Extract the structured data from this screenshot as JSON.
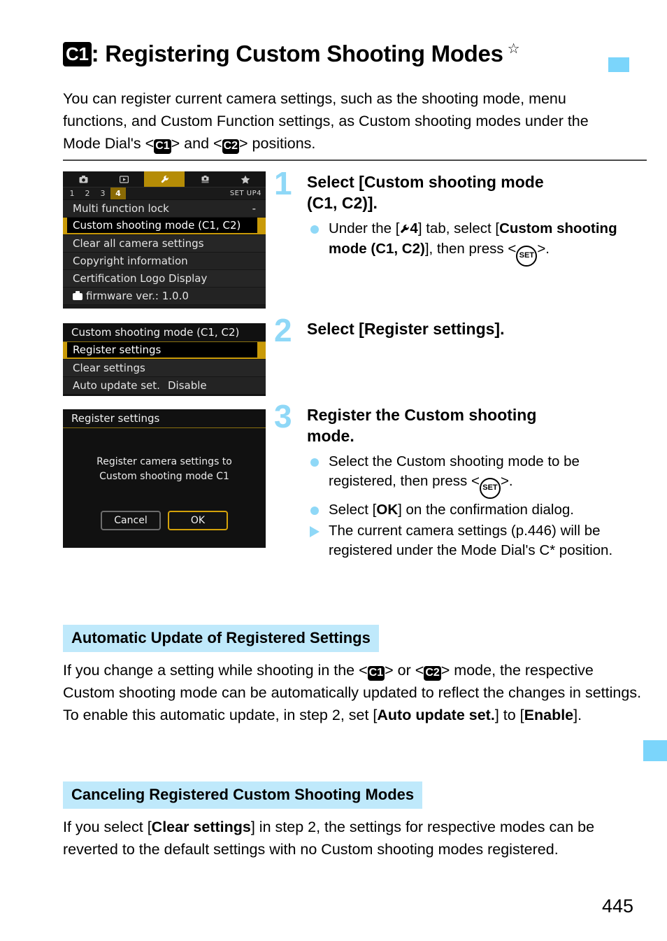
{
  "page": {
    "number": "445",
    "title_badge": "C1",
    "title": ": Registering Custom Shooting Modes",
    "title_star": "☆",
    "intro": "You can register current camera settings, such as the shooting mode, menu functions, and Custom Function settings, as Custom shooting modes under the Mode Dial's <C1> and <C2> positions.",
    "intro_part1": "You can register current camera settings, such as the shooting mode, menu functions, and Custom Function settings, as Custom shooting modes under the Mode Dial's <",
    "intro_badge1": "C1",
    "intro_mid": "> and <",
    "intro_badge2": "C2",
    "intro_part2": "> positions."
  },
  "screenshot1": {
    "tabs": [
      {
        "name": "camera-icon",
        "glyph": "■"
      },
      {
        "name": "playback-icon",
        "glyph": "▶"
      },
      {
        "name": "wrench-icon",
        "glyph": "ƒ"
      },
      {
        "name": "custom-functions-icon",
        "glyph": "■"
      },
      {
        "name": "my-menu-star-icon",
        "glyph": "★"
      }
    ],
    "page_numbers": [
      "1",
      "2",
      "3",
      "4"
    ],
    "active_page": "4",
    "setup_label": "SET UP4",
    "rows": [
      {
        "label": "Multi function lock",
        "value": "-",
        "selected": false,
        "camera_icon": false
      },
      {
        "label": "Custom shooting mode (C1, C2)",
        "value": "",
        "selected": true,
        "camera_icon": false
      },
      {
        "label": "Clear all camera settings",
        "value": "",
        "selected": false,
        "camera_icon": false
      },
      {
        "label": "Copyright information",
        "value": "",
        "selected": false,
        "camera_icon": false
      },
      {
        "label": "Certification Logo Display",
        "value": "",
        "selected": false,
        "camera_icon": false
      },
      {
        "label": "firmware ver.: 1.0.0",
        "value": "",
        "selected": false,
        "camera_icon": true
      }
    ]
  },
  "screenshot2": {
    "header": "Custom shooting mode (C1, C2)",
    "rows": [
      {
        "label": "Register settings",
        "value": "",
        "selected": true
      },
      {
        "label": "Clear settings",
        "value": "",
        "selected": false
      },
      {
        "label": "Auto update set.",
        "value": "Disable",
        "selected": false
      }
    ]
  },
  "screenshot3": {
    "header": "Register settings",
    "message_line1": "Register camera settings to",
    "message_line2": "Custom shooting mode C1",
    "cancel_label": "Cancel",
    "ok_label": "OK"
  },
  "steps": [
    {
      "number": "1",
      "title_line1": "Select [Custom shooting mode",
      "title_line2": "(C1, C2)].",
      "bullet_prefix": "Under the [",
      "bullet_tab": "4",
      "bullet_mid": "] tab, select [",
      "bullet_bold": "Custom shooting mode (C1, C2)",
      "bullet_suffix": "], then press <",
      "bullet_set": "SET",
      "bullet_end": ">."
    },
    {
      "number": "2",
      "title_line1": "Select [Register settings].",
      "title_line2": ""
    },
    {
      "number": "3",
      "title_line1": "Register the Custom shooting",
      "title_line2": "mode.",
      "b1_pre": "Select the Custom shooting mode to be registered, then press <",
      "b1_set": "SET",
      "b1_post": ">.",
      "b2_pre": "Select [",
      "b2_bold": "OK",
      "b2_post": "] on the confirmation dialog.",
      "b3": "The current camera settings (p.446) will be registered under the Mode Dial's C* position."
    }
  ],
  "sections": [
    {
      "heading": "Automatic Update of Registered Settings",
      "body_p1": "If you change a setting while shooting in the <",
      "badge1": "C1",
      "body_p2": "> or <",
      "badge2": "C2",
      "body_p3": "> mode, the respective Custom shooting mode can be automatically updated to reflect the changes in settings. To enable this automatic update, in step 2, set [",
      "body_bold1": "Auto update set.",
      "body_p4": "] to [",
      "body_bold2": "Enable",
      "body_p5": "]."
    },
    {
      "heading": "Canceling Registered Custom Shooting Modes",
      "body_p1": "If you select [",
      "body_bold1": "Clear settings",
      "body_p2": "] in step 2, the settings for respective modes can be reverted to the default settings with no Custom shooting modes registered."
    }
  ],
  "colors": {
    "accent_blue": "#8fd8f7",
    "section_highlight": "#bfe9fb",
    "menu_gold": "#c99a08",
    "tab_gold": "#b58c06"
  }
}
